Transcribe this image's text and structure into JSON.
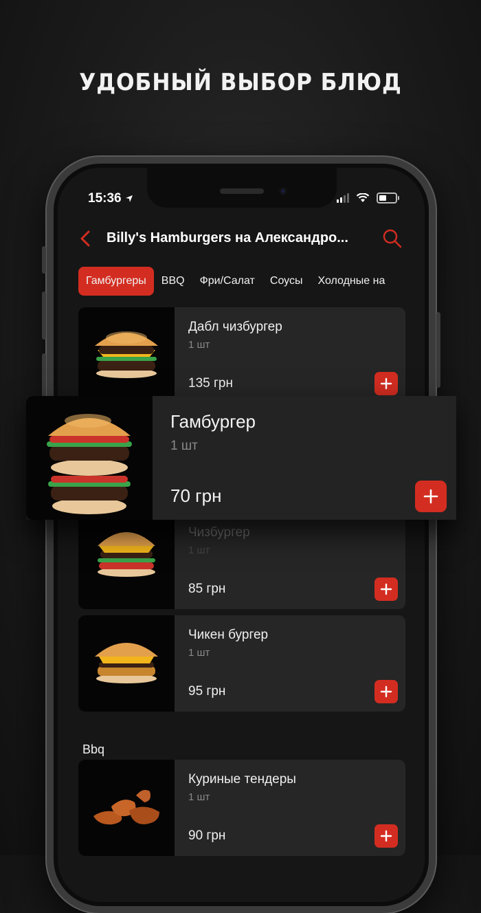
{
  "headline": "УДОБНЫЙ ВЫБОР БЛЮД",
  "status": {
    "time": "15:36"
  },
  "header": {
    "title": "Billy's Hamburgers на Александро..."
  },
  "tabs": [
    {
      "label": "Гамбургеры",
      "active": true
    },
    {
      "label": "BBQ",
      "active": false
    },
    {
      "label": "Фри/Салат",
      "active": false
    },
    {
      "label": "Соусы",
      "active": false
    },
    {
      "label": "Холодные на",
      "active": false
    }
  ],
  "items": [
    {
      "name": "Дабл чизбургер",
      "qty": "1 шт",
      "price": "135 грн"
    },
    {
      "name": "Чизбургер",
      "qty": "1 шт",
      "price": "85 грн"
    },
    {
      "name": "Чикен бургер",
      "qty": "1 шт",
      "price": "95 грн"
    }
  ],
  "section": {
    "title": "Bbq"
  },
  "bbq_items": [
    {
      "name": "Куриные тендеры",
      "qty": "1 шт",
      "price": "90 грн"
    }
  ],
  "highlight": {
    "name": "Гамбургер",
    "qty": "1 шт",
    "price": "70 грн"
  },
  "colors": {
    "accent": "#d32d21",
    "card": "#262626",
    "background": "#161616"
  }
}
